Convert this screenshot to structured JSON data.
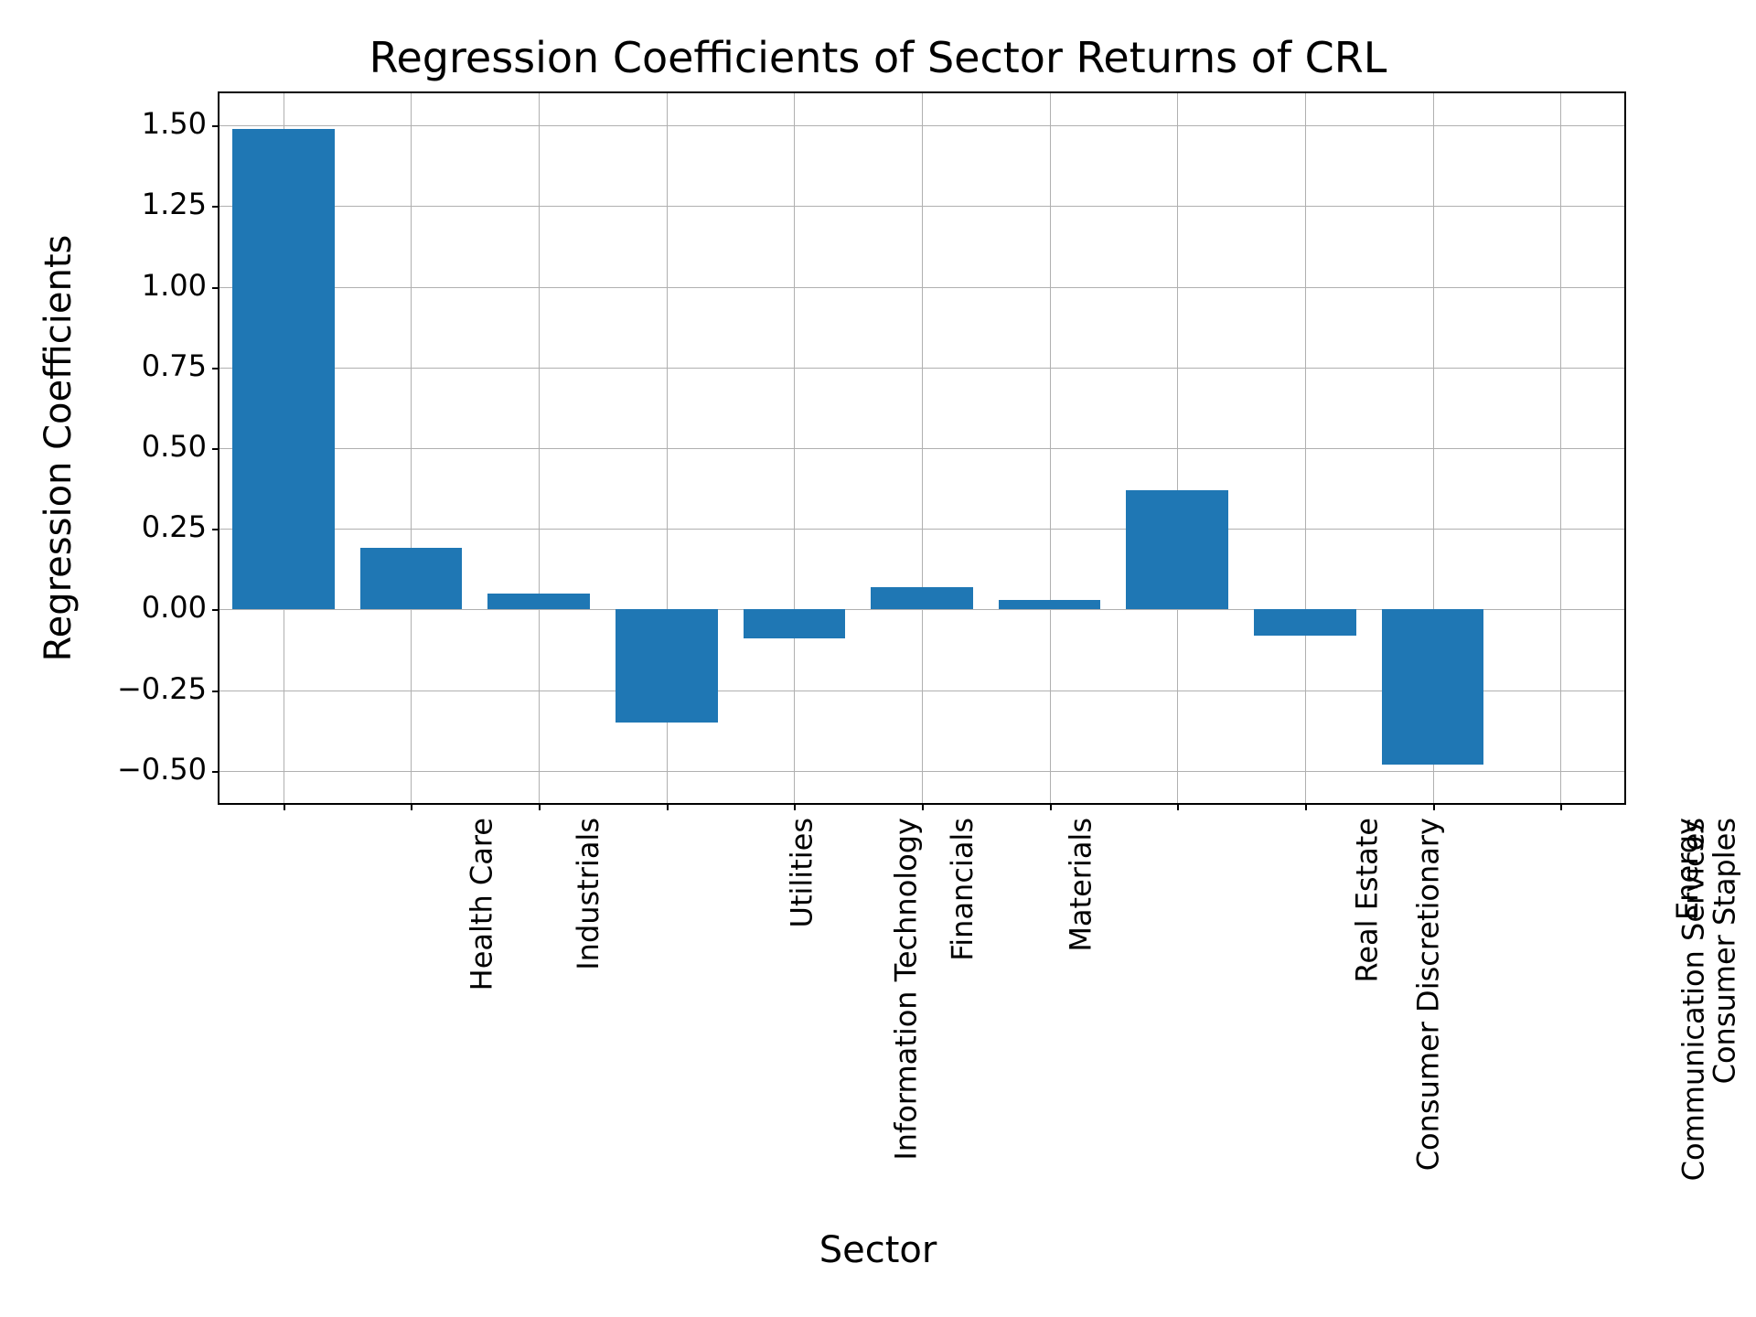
{
  "chart_data": {
    "type": "bar",
    "title": "Regression Coefficients of Sector Returns of CRL",
    "xlabel": "Sector",
    "ylabel": "Regression Coefficients",
    "categories": [
      "Health Care",
      "Industrials",
      "Information Technology",
      "Utilities",
      "Financials",
      "Materials",
      "Consumer Discretionary",
      "Real Estate",
      "Communication Services",
      "Consumer Staples",
      "Energy"
    ],
    "values": [
      1.49,
      0.19,
      0.05,
      -0.35,
      -0.09,
      0.07,
      0.03,
      0.37,
      -0.08,
      -0.48,
      0.0
    ],
    "ylim": [
      -0.6,
      1.6
    ],
    "yticks": [
      -0.5,
      -0.25,
      0.0,
      0.25,
      0.5,
      0.75,
      1.0,
      1.25,
      1.5
    ],
    "ytick_labels": [
      "−0.50",
      "−0.25",
      "0.00",
      "0.25",
      "0.50",
      "0.75",
      "1.00",
      "1.25",
      "1.50"
    ],
    "bar_color": "#1f77b4",
    "grid": true
  }
}
